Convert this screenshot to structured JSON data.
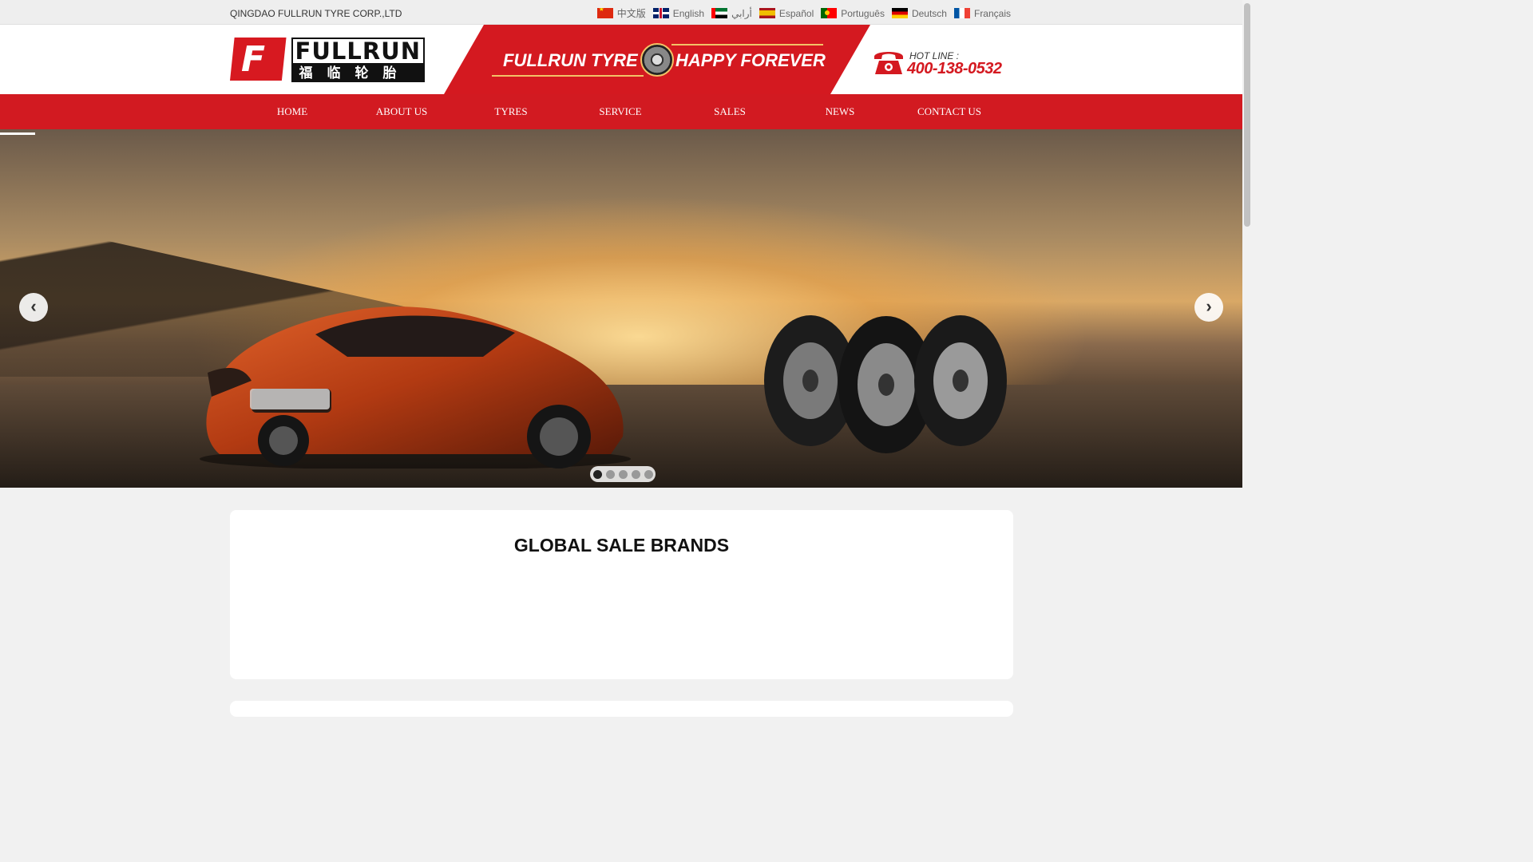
{
  "topbar": {
    "company": "QINGDAO FULLRUN TYRE CORP.,LTD",
    "languages": [
      {
        "label": "中文版",
        "flag": "cn-flag-icon"
      },
      {
        "label": "English",
        "flag": "gb-flag-icon"
      },
      {
        "label": "أرابي",
        "flag": "ae-flag-icon"
      },
      {
        "label": "Español",
        "flag": "es-flag-icon"
      },
      {
        "label": "Português",
        "flag": "pt-flag-icon"
      },
      {
        "label": "Deutsch",
        "flag": "de-flag-icon"
      },
      {
        "label": "Français",
        "flag": "fr-flag-icon"
      }
    ]
  },
  "header": {
    "logo_en": "FULLRUN",
    "logo_cn": "福临轮胎",
    "slogan_left": "FULLRUN TYRE",
    "slogan_right": "HAPPY FOREVER",
    "hotline_label": "HOT LINE :",
    "hotline_number": "400-138-0532"
  },
  "nav": {
    "items": [
      {
        "label": "HOME"
      },
      {
        "label": "ABOUT US"
      },
      {
        "label": "TYRES"
      },
      {
        "label": "SERVICE"
      },
      {
        "label": "SALES"
      },
      {
        "label": "NEWS"
      },
      {
        "label": "CONTACT US"
      }
    ]
  },
  "slider": {
    "prev_icon": "chevron-left-icon",
    "next_icon": "chevron-right-icon",
    "slide_count": 5,
    "active_slide": 1
  },
  "main": {
    "section_title": "GLOBAL SALE BRANDS"
  },
  "colors": {
    "brand_red": "#d21a21",
    "hotline_red": "#d41920",
    "gold": "#f3c267"
  }
}
